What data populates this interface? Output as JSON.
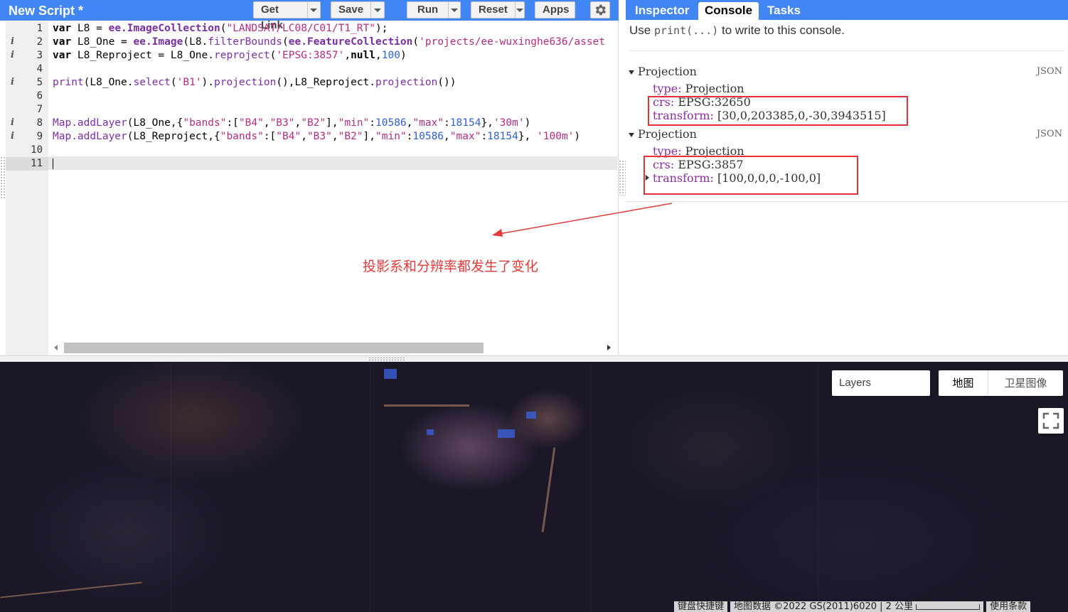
{
  "editor": {
    "script_title": "New Script *",
    "buttons": {
      "get_link": "Get Link",
      "save": "Save",
      "run": "Run",
      "reset": "Reset",
      "apps": "Apps"
    },
    "line_numbers": [
      "1",
      "2",
      "3",
      "4",
      "5",
      "6",
      "7",
      "8",
      "9",
      "10",
      "11"
    ],
    "info_markers_on_lines": [
      2,
      3,
      5,
      8,
      9
    ],
    "code": {
      "l1": {
        "a": "var ",
        "b": "L8",
        "c": " = ",
        "d": "ee.ImageCollection",
        "e": "(",
        "f": "\"LANDSAT/LC08/C01/T1_RT\"",
        "g": ");"
      },
      "l2": {
        "a": "var ",
        "b": "L8_One",
        "c": " = ",
        "d": "ee.Image",
        "e": "(L8.",
        "f": "filterBounds",
        "g": "(",
        "h": "ee.FeatureCollection",
        "i": "(",
        "j": "'projects/ee-wuxinghe636/asset"
      },
      "l3": {
        "a": "var ",
        "b": "L8_Reproject",
        "c": " = L8_One.",
        "d": "reproject",
        "e": "(",
        "f": "'EPSG:3857'",
        "g": ",",
        "h": "null",
        "i": ",",
        "j": "100",
        "k": ")"
      },
      "l5": {
        "a": "print",
        "b": "(L8_One.",
        "c": "select",
        "d": "(",
        "e": "'B1'",
        "f": ").",
        "g": "projection",
        "h": "(),L8_Reproject.",
        "i": "projection",
        "j": "())"
      },
      "l8": {
        "a": "Map.addLayer",
        "b": "(L8_One,{",
        "c": "\"bands\"",
        "d": ":[",
        "e": "\"B4\"",
        "f": ",",
        "g": "\"B3\"",
        "h": ",",
        "i": "\"B2\"",
        "j": "],",
        "k": "\"min\"",
        "l": ":",
        "m": "10586",
        "n": ",",
        "o": "\"max\"",
        "p": ":",
        "q": "18154",
        "r": "},",
        "s": "'30m'",
        "t": ")"
      },
      "l9": {
        "a": "Map.addLayer",
        "b": "(L8_Reproject,{",
        "c": "\"bands\"",
        "d": ":[",
        "e": "\"B4\"",
        "f": ",",
        "g": "\"B3\"",
        "h": ",",
        "i": "\"B2\"",
        "j": "],",
        "k": "\"min\"",
        "l": ":",
        "m": "10586",
        "n": ",",
        "o": "\"max\"",
        "p": ":",
        "q": "18154",
        "r": "}, ",
        "s": "'100m'",
        "t": ")"
      }
    }
  },
  "console": {
    "tabs": {
      "inspector": "Inspector",
      "console": "Console",
      "tasks": "Tasks"
    },
    "hint": {
      "pre": "Use ",
      "code": "print(...)",
      "post": " to write to this console."
    },
    "outputs": [
      {
        "title": "Projection",
        "json_label": "JSON",
        "type_key": "type:",
        "type_val": "Projection",
        "crs_key": "crs:",
        "crs_val": "EPSG:32650",
        "transform_key": "transform:",
        "transform_val": "[30,0,203385,0,-30,3943515]"
      },
      {
        "title": "Projection",
        "json_label": "JSON",
        "type_key": "type:",
        "type_val": "Projection",
        "crs_key": "crs:",
        "crs_val": "EPSG:3857",
        "transform_key": "transform:",
        "transform_val": "[100,0,0,0,-100,0]"
      }
    ]
  },
  "annotation": {
    "text": "投影系和分辨率都发生了变化",
    "color": "#e33b3b"
  },
  "map": {
    "layers_label": "Layers",
    "map_type_options": [
      "地图",
      "卫星图像"
    ],
    "attribution": {
      "shortcuts": "键盘快捷键",
      "data": "地图数据 ©2022 GS(2011)6020",
      "scale": "2 公里",
      "terms": "使用条款"
    }
  },
  "colors": {
    "toolbar_blue": "#4285f4",
    "highlight_red": "#e8303a"
  }
}
